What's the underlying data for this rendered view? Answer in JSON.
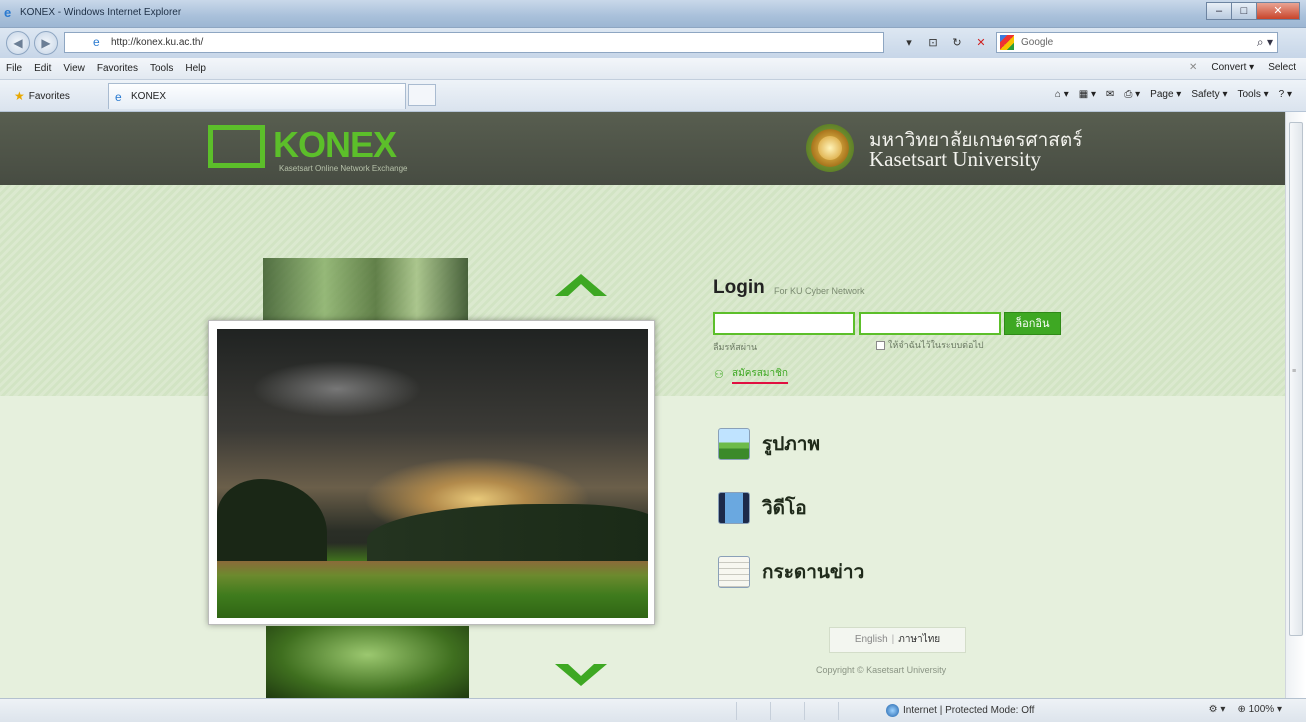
{
  "window": {
    "title": "KONEX - Windows Internet Explorer"
  },
  "address": {
    "url": "http://konex.ku.ac.th/"
  },
  "search": {
    "placeholder": "Google"
  },
  "menubar": {
    "items": [
      "File",
      "Edit",
      "View",
      "Favorites",
      "Tools",
      "Help"
    ],
    "convert": "Convert",
    "select": "Select"
  },
  "favbar": {
    "favorites": "Favorites",
    "tab": "KONEX",
    "commands": [
      "Page ▾",
      "Safety ▾",
      "Tools ▾"
    ]
  },
  "site": {
    "logo_text": "KONEX",
    "tagline": "Kasetsart Online Network Exchange",
    "university_thai": "มหาวิทยาลัยเกษตรศาสตร์",
    "university_eng": "Kasetsart University"
  },
  "login": {
    "title": "Login",
    "subtitle": "For KU Cyber Network",
    "button": "ล็อกอิน",
    "forgot": "ลืมรหัสผ่าน",
    "remember": "ให้จำฉันไว้ในระบบต่อไป",
    "register": "สมัครสมาชิก"
  },
  "menu": {
    "photo": "รูปภาพ",
    "video": "วิดีโอ",
    "board": "กระดานข่าว"
  },
  "language": {
    "english": "English",
    "thai": "ภาษาไทย"
  },
  "copyright": "Copyright © Kasetsart University",
  "status": {
    "zone": "Internet | Protected Mode: Off",
    "zoom": "100%"
  }
}
